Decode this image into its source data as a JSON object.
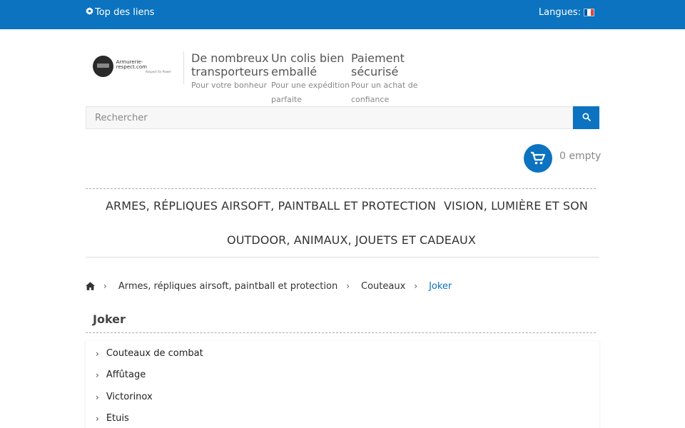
{
  "topbar": {
    "links_label": "Top des liens",
    "languages_label": "Langues:",
    "flag_colors": [
      "#0055a4",
      "#ffffff",
      "#ef4135"
    ]
  },
  "logo": {
    "name": "Armurerie-respect.com",
    "tagline": "Respect for Power"
  },
  "features": [
    {
      "title": "De nombreux transporteurs",
      "subtitle": "Pour votre bonheur"
    },
    {
      "title": "Un colis bien emballé",
      "subtitle": "Pour une expédition parfaite"
    },
    {
      "title": "Paiement sécurisé",
      "subtitle": "Pour un achat de confiance"
    }
  ],
  "search": {
    "placeholder": "Rechercher",
    "icon": "search-icon"
  },
  "cart": {
    "label": "0 empty",
    "icon": "cart-icon"
  },
  "menu": {
    "items": [
      "ARMES, RÉPLIQUES AIRSOFT, PAINTBALL ET PROTECTION",
      "VISION, LUMIÈRE ET SON",
      "OUTDOOR, ANIMAUX, JOUETS ET CADEAUX"
    ]
  },
  "breadcrumb": {
    "home_icon": "home-icon",
    "items": [
      "Armes, répliques airsoft, paintball et protection",
      "Couteaux"
    ],
    "current": "Joker"
  },
  "page": {
    "title": "Joker"
  },
  "subcategories": [
    "Couteaux de combat",
    "Affûtage",
    "Victorinox",
    "Etuis"
  ],
  "colors": {
    "accent": "#0b73bf",
    "text": "#333333",
    "muted": "#888888"
  }
}
